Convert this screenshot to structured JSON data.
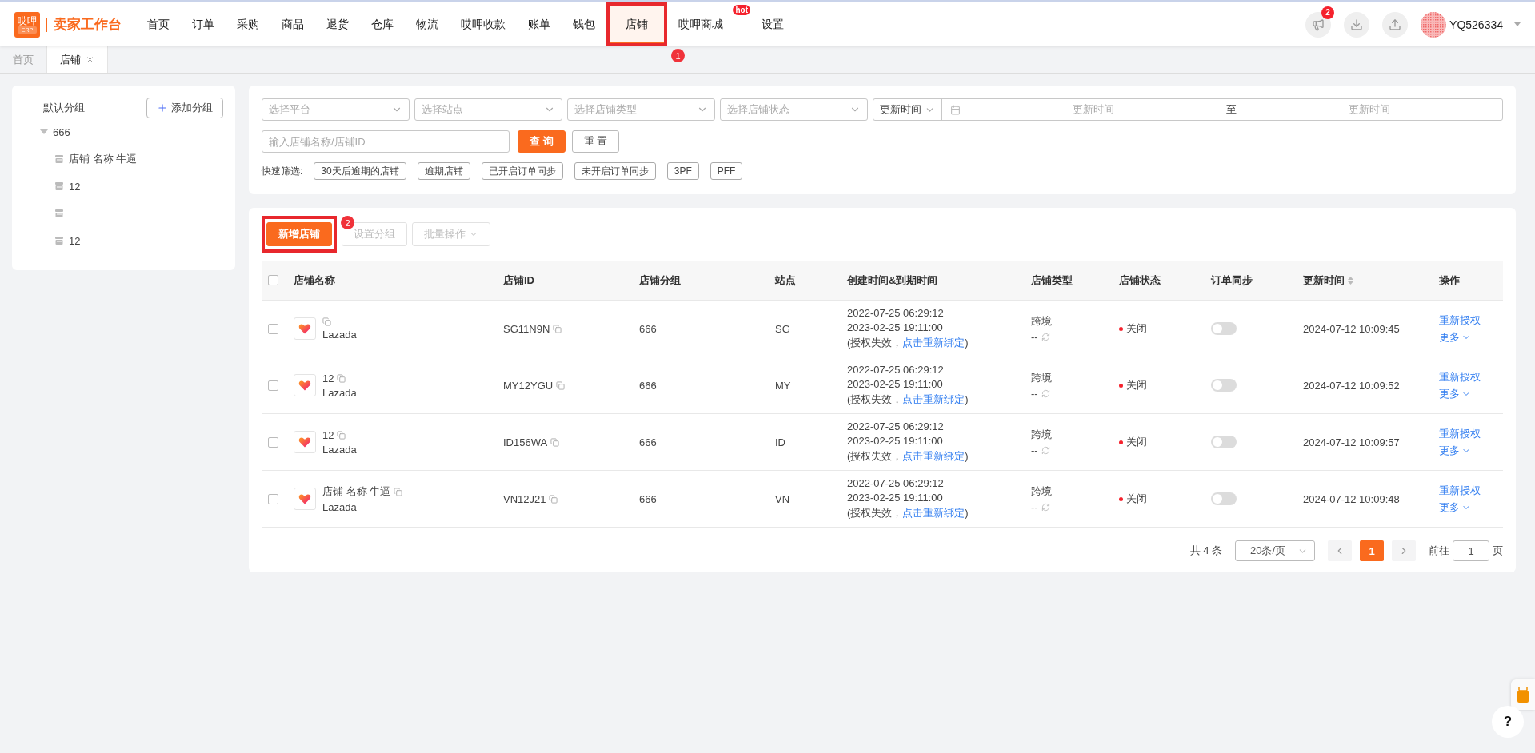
{
  "app": {
    "logo_mark": "哎呷",
    "logo_sub": "ERP",
    "title": "卖家工作台"
  },
  "nav": [
    {
      "label": "首页",
      "selected": false
    },
    {
      "label": "订单",
      "selected": false
    },
    {
      "label": "采购",
      "selected": false
    },
    {
      "label": "商品",
      "selected": false
    },
    {
      "label": "退货",
      "selected": false
    },
    {
      "label": "仓库",
      "selected": false
    },
    {
      "label": "物流",
      "selected": false
    },
    {
      "label": "哎呷收款",
      "selected": false
    },
    {
      "label": "账单",
      "selected": false
    },
    {
      "label": "钱包",
      "selected": false
    },
    {
      "label": "店铺",
      "selected": true,
      "callout": "1"
    },
    {
      "label": "哎呷商城",
      "selected": false,
      "badge": "hot"
    },
    {
      "label": "设置",
      "selected": false
    }
  ],
  "header_actions": [
    {
      "kind": "announce",
      "badge": "2"
    },
    {
      "kind": "download"
    },
    {
      "kind": "upload"
    }
  ],
  "user": {
    "name": "YQ526334"
  },
  "page_tabs": [
    {
      "label": "首页",
      "selected": false,
      "closable": false
    },
    {
      "label": "店铺",
      "selected": true,
      "closable": true
    }
  ],
  "sidebar": {
    "title": "默认分组",
    "add_button": "添加分组",
    "groups": [
      {
        "label": "666",
        "expanded": true,
        "children": [
          {
            "kind": "store",
            "label": "店铺 名称 牛逼"
          },
          {
            "kind": "store",
            "label": "12"
          },
          {
            "kind": "store"
          },
          {
            "kind": "store",
            "label": "12"
          }
        ]
      }
    ]
  },
  "filters": {
    "selects": [
      {
        "placeholder": "选择平台"
      },
      {
        "placeholder": "选择站点"
      },
      {
        "placeholder": "选择店铺类型"
      },
      {
        "placeholder": "选择店铺状态"
      }
    ],
    "date_range": {
      "field": "更新时间",
      "start_placeholder": "更新时间",
      "separator": "至",
      "end_placeholder": "更新时间"
    },
    "search": {
      "placeholder": "输入店铺名称/店铺ID"
    },
    "buttons": [
      {
        "label": "查 询",
        "kind": "primary"
      },
      {
        "label": "重 置",
        "kind": "default"
      }
    ],
    "quick_label": "快速筛选:",
    "quick_filters": [
      "30天后逾期的店铺",
      "逾期店铺",
      "已开启订单同步",
      "未开启订单同步",
      "3PF",
      "PFF"
    ]
  },
  "toolbar": {
    "buttons": [
      {
        "label": "新增店铺",
        "kind": "primary",
        "disabled": false,
        "callout": "2"
      },
      {
        "label": "设置分组",
        "kind": "default",
        "disabled": true
      },
      {
        "label": "批量操作",
        "kind": "default",
        "disabled": true,
        "dropdown": true
      }
    ]
  },
  "table": {
    "all_checked": false,
    "columns": [
      {
        "label": "店铺名称"
      },
      {
        "label": "店铺ID"
      },
      {
        "label": "店铺分组"
      },
      {
        "label": "站点"
      },
      {
        "label": "创建时间&到期时间"
      },
      {
        "label": "店铺类型"
      },
      {
        "label": "店铺状态"
      },
      {
        "label": "订单同步"
      },
      {
        "label": "更新时间",
        "sortable": true
      },
      {
        "label": "操作"
      }
    ],
    "rows": [
      {
        "checked": false,
        "platform": "Lazada",
        "store_id": "SG11N9N",
        "group": "666",
        "site": "SG",
        "created": "2022-07-25 06:29:12",
        "expires": "2023-02-25 19:11:00",
        "auth_prefix": "(授权失效，",
        "auth_link": "点击重新绑定",
        "auth_suffix": ")",
        "type": "跨境",
        "type_sub": "--",
        "status": {
          "label": "关闭",
          "color": "#f5222d"
        },
        "sync_on": false,
        "updated": "2024-07-12 10:09:45",
        "actions": [
          "重新授权",
          "更多"
        ]
      },
      {
        "checked": false,
        "name": "12",
        "platform": "Lazada",
        "store_id": "MY12YGU",
        "group": "666",
        "site": "MY",
        "created": "2022-07-25 06:29:12",
        "expires": "2023-02-25 19:11:00",
        "auth_prefix": "(授权失效，",
        "auth_link": "点击重新绑定",
        "auth_suffix": ")",
        "type": "跨境",
        "type_sub": "--",
        "status": {
          "label": "关闭",
          "color": "#f5222d"
        },
        "sync_on": false,
        "updated": "2024-07-12 10:09:52",
        "actions": [
          "重新授权",
          "更多"
        ]
      },
      {
        "checked": false,
        "name": "12",
        "platform": "Lazada",
        "store_id": "ID156WA",
        "group": "666",
        "site": "ID",
        "created": "2022-07-25 06:29:12",
        "expires": "2023-02-25 19:11:00",
        "auth_prefix": "(授权失效，",
        "auth_link": "点击重新绑定",
        "auth_suffix": ")",
        "type": "跨境",
        "type_sub": "--",
        "status": {
          "label": "关闭",
          "color": "#f5222d"
        },
        "sync_on": false,
        "updated": "2024-07-12 10:09:57",
        "actions": [
          "重新授权",
          "更多"
        ]
      },
      {
        "checked": false,
        "name": "店铺 名称 牛逼",
        "platform": "Lazada",
        "store_id": "VN12J21",
        "group": "666",
        "site": "VN",
        "created": "2022-07-25 06:29:12",
        "expires": "2023-02-25 19:11:00",
        "auth_prefix": "(授权失效，",
        "auth_link": "点击重新绑定",
        "auth_suffix": ")",
        "type": "跨境",
        "type_sub": "--",
        "status": {
          "label": "关闭",
          "color": "#f5222d"
        },
        "sync_on": false,
        "updated": "2024-07-12 10:09:48",
        "actions": [
          "重新授权",
          "更多"
        ]
      }
    ]
  },
  "pagination": {
    "total": "共 4 条",
    "page_size": "20条/页",
    "pages": [
      {
        "label": "1",
        "selected": true
      }
    ],
    "goto_label": "前往",
    "goto_value": "1",
    "goto_suffix": "页"
  },
  "floating": {
    "help": "?"
  }
}
